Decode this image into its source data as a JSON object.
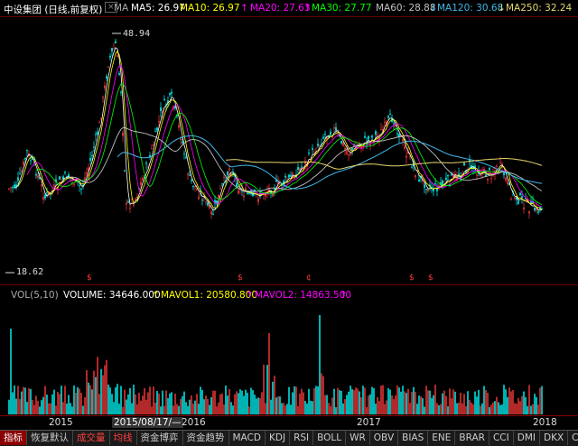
{
  "colors": {
    "up": "#ff3b3b",
    "down": "#00ffff",
    "ma5": "#ffffff",
    "ma10": "#ffff00",
    "ma20": "#ff00ff",
    "ma30": "#00ff00",
    "ma60": "#c0c0c0",
    "ma120": "#3fb8e8",
    "ma250": "#e6d86e"
  },
  "header": {
    "title": "中设集团 (日线,前复权)",
    "x_icon": "close-icon",
    "ma_label": "MA",
    "ma5": "MA5: 26.97",
    "ma10": "MA10: 26.97",
    "ma20": "MA20: 27.63",
    "ma30": "MA30: 27.77",
    "ma60": "MA60: 28.88",
    "ma120": "MA120: 30.68",
    "ma250": "MA250: 32.24",
    "arrow_up": "↑",
    "arrow_down": "↓"
  },
  "price": {
    "high_label": "48.94",
    "low_label": "18.62",
    "axis_marker_up": "-",
    "markers": [
      "$",
      "$",
      "¢",
      "$",
      "$"
    ]
  },
  "volume": {
    "label": "VOL(5,10)",
    "volume": "VOLUME: 34646.000",
    "mavol1": "MAVOL1: 20580.800",
    "mavol2": "MAVOL2: 14863.500",
    "arrow_up": "↑"
  },
  "xaxis": {
    "labels": [
      "2015",
      "2015/08/17/—",
      "2016",
      "2017",
      "2018"
    ]
  },
  "tabs": [
    "指标",
    "恢复默认",
    "成交量",
    "均线",
    "资金博弈",
    "资金趋势",
    "MACD",
    "KDJ",
    "RSI",
    "BOLL",
    "WR",
    "OBV",
    "BIAS",
    "ENE",
    "BRAR",
    "CCI",
    "DMI",
    "DKX",
    "CR"
  ]
}
